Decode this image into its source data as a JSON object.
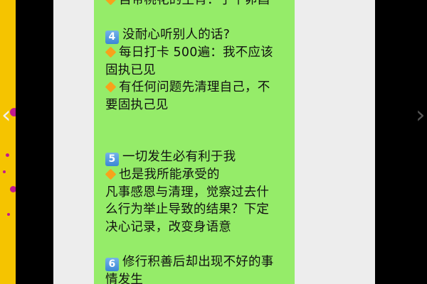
{
  "message": {
    "lines": [
      {
        "kind": "diamond",
        "text": "自带桃花的生肖：子午卯酉"
      },
      {
        "kind": "gap"
      },
      {
        "kind": "keycap",
        "key": "4",
        "text": "没耐心听别人的话?"
      },
      {
        "kind": "diamond",
        "text": "每日打卡 500遍：我不应该"
      },
      {
        "kind": "plain",
        "text": "固执已见"
      },
      {
        "kind": "diamond",
        "text": "有任何问题先清理自己，不"
      },
      {
        "kind": "plain",
        "text": "要固执己见"
      },
      {
        "kind": "gap"
      },
      {
        "kind": "gap"
      },
      {
        "kind": "keycap",
        "key": "5",
        "text": "一切发生必有利于我"
      },
      {
        "kind": "diamond",
        "text": "也是我所能承受的"
      },
      {
        "kind": "plain",
        "text": "凡事感恩与清理，觉察过去什"
      },
      {
        "kind": "plain",
        "text": "么行为举止导致的结果？下定"
      },
      {
        "kind": "plain",
        "text": "决心记录，改变身语意"
      },
      {
        "kind": "gap"
      },
      {
        "kind": "keycap",
        "key": "6",
        "text": "修行积善后却出现不好的事"
      },
      {
        "kind": "plain",
        "text": "情发生"
      }
    ]
  },
  "colors": {
    "bubble": "#95ec69",
    "panel": "#ededed",
    "left_strip": "#f5c400",
    "diamond": "#f7a21b"
  }
}
